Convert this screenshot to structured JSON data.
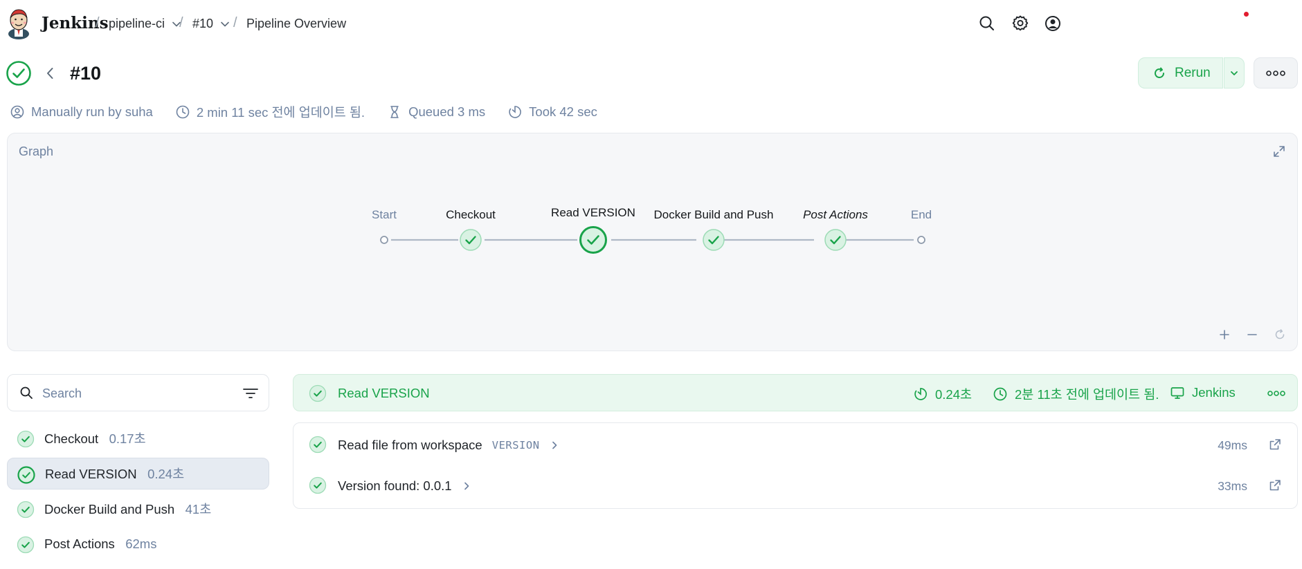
{
  "header": {
    "brand": "Jenkins",
    "breadcrumbs": [
      {
        "label": "pipeline-ci",
        "has_dropdown": true
      },
      {
        "label": "#10",
        "has_dropdown": true
      },
      {
        "label": "Pipeline Overview",
        "has_dropdown": false
      }
    ],
    "icons": [
      "search-icon",
      "gear-icon",
      "user-icon"
    ],
    "notification_dot_color": "#e11d2f"
  },
  "build": {
    "title": "#10",
    "status": "success",
    "rerun_label": "Rerun",
    "meta": {
      "run_by": "Manually run by suha",
      "updated": "2 min 11 sec 전에 업데이트 됨.",
      "queued": "Queued 3 ms",
      "took": "Took 42 sec"
    }
  },
  "graph": {
    "title": "Graph",
    "stages": [
      {
        "label": "Start",
        "kind": "terminal"
      },
      {
        "label": "Checkout",
        "kind": "success"
      },
      {
        "label": "Read VERSION",
        "kind": "success",
        "selected": true
      },
      {
        "label": "Docker Build and Push",
        "kind": "success"
      },
      {
        "label": "Post Actions",
        "kind": "success",
        "italic": true
      },
      {
        "label": "End",
        "kind": "terminal"
      }
    ],
    "zoom_controls": [
      "plus-icon",
      "minus-icon",
      "reset-icon"
    ]
  },
  "stage_list": {
    "search_placeholder": "Search",
    "items": [
      {
        "name": "Checkout",
        "duration": "0.17초"
      },
      {
        "name": "Read VERSION",
        "duration": "0.24초",
        "selected": true
      },
      {
        "name": "Docker Build and Push",
        "duration": "41초"
      },
      {
        "name": "Post Actions",
        "duration": "62ms"
      }
    ]
  },
  "step_detail": {
    "title": "Read VERSION",
    "duration": "0.24초",
    "updated": "2분 11초 전에 업데이트 됨.",
    "agent": "Jenkins",
    "steps": [
      {
        "name": "Read file from workspace",
        "arg": "VERSION",
        "time": "49ms"
      },
      {
        "name": "Version found: 0.0.1",
        "arg": "",
        "time": "33ms"
      }
    ]
  },
  "colors": {
    "success": "#19a34a",
    "success_bg": "#e9f8ef",
    "muted": "#6e82a0",
    "selected_bg": "#e6ebf2"
  }
}
